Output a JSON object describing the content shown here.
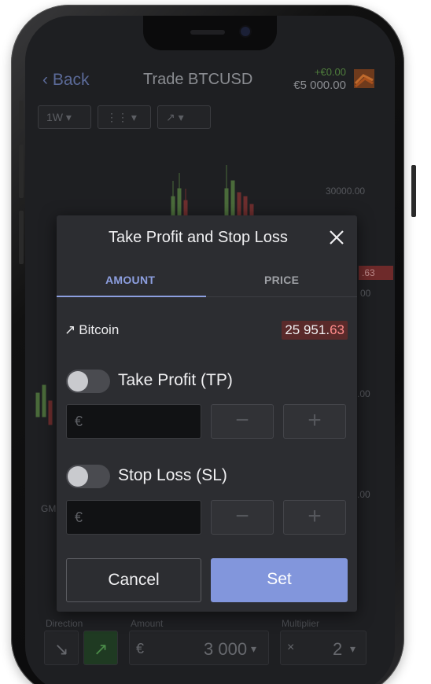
{
  "app": {
    "back_label": "Back",
    "title": "Trade BTCUSD",
    "balance_delta": "+€0.00",
    "balance": "€5 000.00"
  },
  "toolbar": {
    "timeframe": "1W",
    "chart_type_icon": "candles-icon",
    "trend_icon": "trend-arrow-icon"
  },
  "chart": {
    "axis_labels": [
      "30000.00",
      "00",
      "00",
      ".00",
      ".00"
    ],
    "price_tag": ".63",
    "gmt_label": "GM"
  },
  "bottom": {
    "direction_label": "Direction",
    "amount_label": "Amount",
    "amount_currency": "€",
    "amount_value": "3 000",
    "multiplier_label": "Multiplier",
    "multiplier_prefix": "×",
    "multiplier_value": "2"
  },
  "modal": {
    "title": "Take Profit and Stop Loss",
    "tabs": [
      {
        "label": "AMOUNT",
        "active": true
      },
      {
        "label": "PRICE",
        "active": false
      }
    ],
    "asset_name": "Bitcoin",
    "asset_icon": "trend-up-arrow-icon",
    "quote_main": "25 951.",
    "quote_decimals": "63",
    "take_profit": {
      "label": "Take Profit (TP)",
      "enabled": false,
      "currency": "€",
      "value": ""
    },
    "stop_loss": {
      "label": "Stop Loss (SL)",
      "enabled": false,
      "currency": "€",
      "value": ""
    },
    "stepper_minus": "−",
    "stepper_plus": "+",
    "cancel_label": "Cancel",
    "set_label": "Set"
  },
  "colors": {
    "accent": "#8296dc",
    "modal_bg": "#2c2d31",
    "quote_bg": "#5a2a2a",
    "quote_decimals": "#ff8b8b"
  }
}
